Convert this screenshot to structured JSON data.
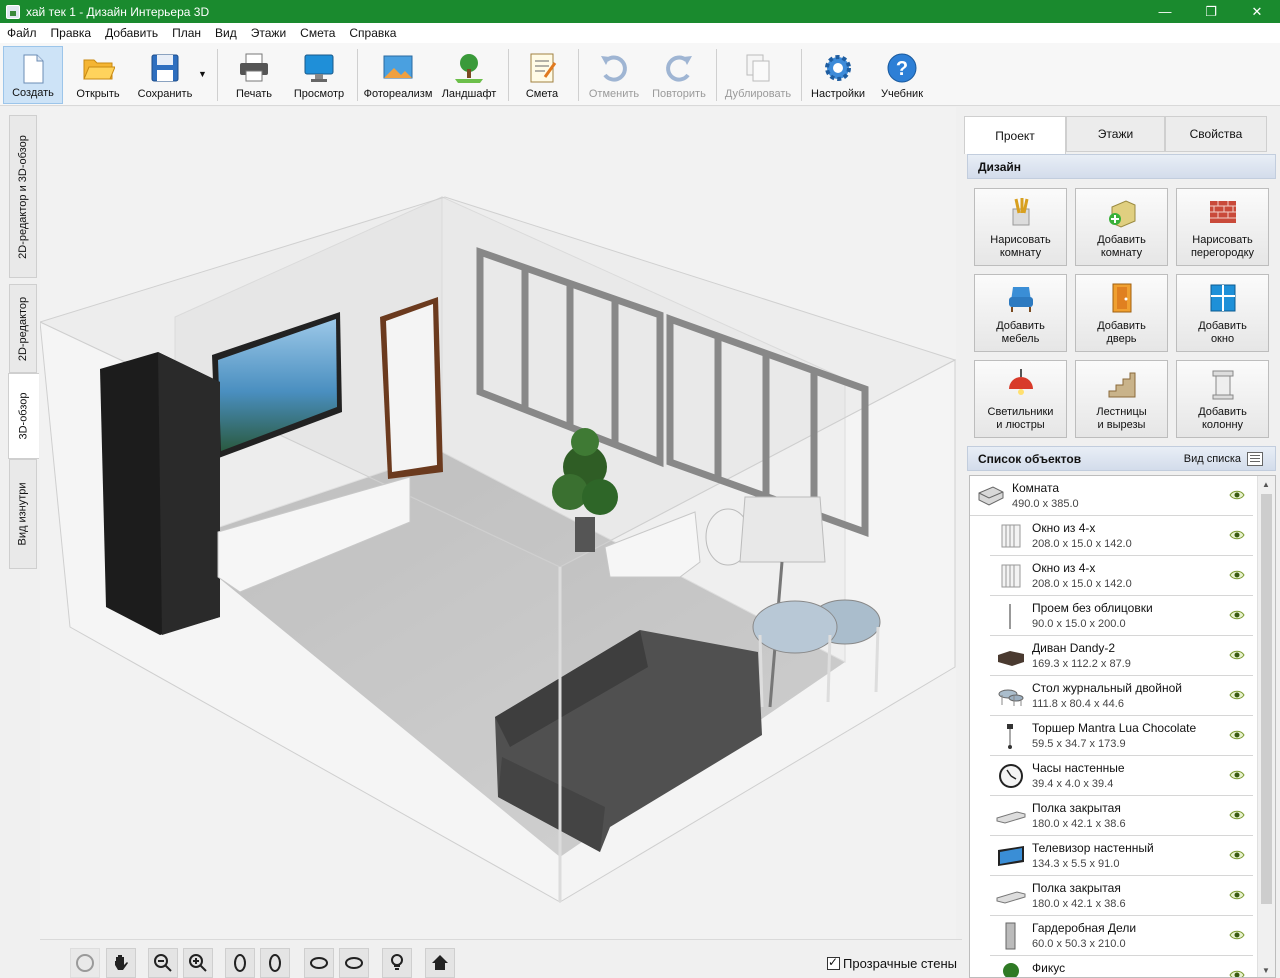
{
  "window": {
    "title": "хай тек 1 - Дизайн Интерьера 3D",
    "minimize": "—",
    "maximize": "❐",
    "close": "✕"
  },
  "menu": [
    "Файл",
    "Правка",
    "Добавить",
    "План",
    "Вид",
    "Этажи",
    "Смета",
    "Справка"
  ],
  "toolbar": {
    "create": "Создать",
    "open": "Открыть",
    "save": "Сохранить",
    "print": "Печать",
    "preview": "Просмотр",
    "photoreal": "Фотореализм",
    "landscape": "Ландшафт",
    "estimate": "Смета",
    "undo": "Отменить",
    "redo": "Повторить",
    "duplicate": "Дублировать",
    "settings": "Настройки",
    "tutorial": "Учебник"
  },
  "left_tabs": [
    "2D-редактор и 3D-обзор",
    "2D-редактор",
    "3D-обзор",
    "Вид изнутри"
  ],
  "bottom": {
    "transparent_walls": "Прозрачные стены",
    "transparent_checked": true
  },
  "right_tabs": [
    "Проект",
    "Этажи",
    "Свойства"
  ],
  "design": {
    "header": "Дизайн",
    "buttons": [
      {
        "l1": "Нарисовать",
        "l2": "комнату",
        "icon": "draw-room-icon"
      },
      {
        "l1": "Добавить",
        "l2": "комнату",
        "icon": "add-room-icon"
      },
      {
        "l1": "Нарисовать",
        "l2": "перегородку",
        "icon": "brick-wall-icon"
      },
      {
        "l1": "Добавить",
        "l2": "мебель",
        "icon": "armchair-icon"
      },
      {
        "l1": "Добавить",
        "l2": "дверь",
        "icon": "door-icon"
      },
      {
        "l1": "Добавить",
        "l2": "окно",
        "icon": "window-icon"
      },
      {
        "l1": "Светильники",
        "l2": "и люстры",
        "icon": "lamp-icon"
      },
      {
        "l1": "Лестницы",
        "l2": "и вырезы",
        "icon": "stairs-icon"
      },
      {
        "l1": "Добавить",
        "l2": "колонну",
        "icon": "column-icon"
      }
    ]
  },
  "objects": {
    "header": "Список объектов",
    "view_label": "Вид списка",
    "items": [
      {
        "name": "Комната",
        "dims": "490.0 x 385.0",
        "child": false,
        "icon": "room-icon"
      },
      {
        "name": "Окно из 4-х",
        "dims": "208.0 x 15.0 x 142.0",
        "child": true,
        "icon": "window-icon"
      },
      {
        "name": "Окно из 4-х",
        "dims": "208.0 x 15.0 x 142.0",
        "child": true,
        "icon": "window-icon"
      },
      {
        "name": "Проем без облицовки",
        "dims": "90.0 x 15.0 x 200.0",
        "child": true,
        "icon": "opening-icon"
      },
      {
        "name": "Диван Dandy-2",
        "dims": "169.3 x 112.2 x 87.9",
        "child": true,
        "icon": "sofa-icon"
      },
      {
        "name": "Стол журнальный двойной",
        "dims": "111.8 x 80.4 x 44.6",
        "child": true,
        "icon": "table-icon"
      },
      {
        "name": "Торшер Mantra Lua Chocolate",
        "dims": "59.5 x 34.7 x 173.9",
        "child": true,
        "icon": "floor-lamp-icon"
      },
      {
        "name": "Часы настенные",
        "dims": "39.4 x 4.0 x 39.4",
        "child": true,
        "icon": "clock-icon"
      },
      {
        "name": "Полка закрытая",
        "dims": "180.0 x 42.1 x 38.6",
        "child": true,
        "icon": "shelf-icon"
      },
      {
        "name": "Телевизор настенный",
        "dims": "134.3 x 5.5 x 91.0",
        "child": true,
        "icon": "tv-icon"
      },
      {
        "name": "Полка закрытая",
        "dims": "180.0 x 42.1 x 38.6",
        "child": true,
        "icon": "shelf-icon"
      },
      {
        "name": "Гардеробная Дели",
        "dims": "60.0 x 50.3 x 210.0",
        "child": true,
        "icon": "wardrobe-icon"
      },
      {
        "name": "Фикус",
        "dims": "",
        "child": true,
        "icon": "plant-icon"
      }
    ]
  }
}
